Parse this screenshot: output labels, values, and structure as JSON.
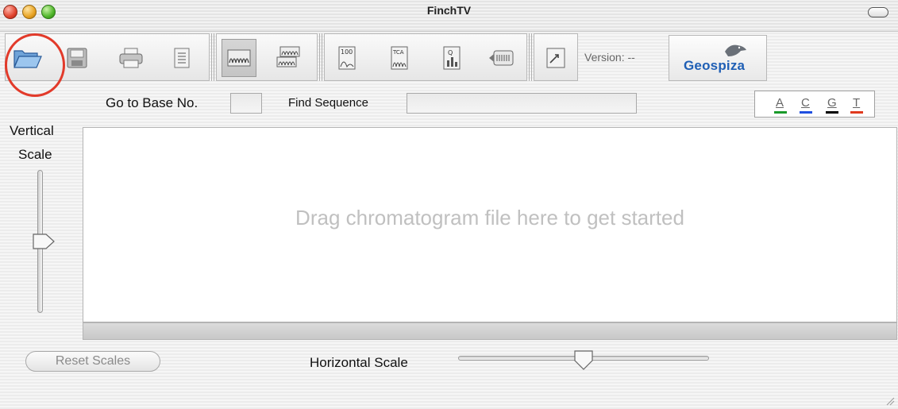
{
  "window": {
    "title": "FinchTV"
  },
  "toolbar": {
    "version_label": "Version: --",
    "brand": "Geospiza",
    "buttons": [
      {
        "name": "open-file-button",
        "icon": "folder-open-icon"
      },
      {
        "name": "save-button",
        "icon": "floppy-disk-icon"
      },
      {
        "name": "print-button",
        "icon": "printer-icon"
      },
      {
        "name": "sequence-text-button",
        "icon": "document-lines-icon"
      },
      {
        "name": "single-view-button",
        "icon": "chromatogram-icon",
        "pressed": true
      },
      {
        "name": "multi-view-button",
        "icon": "stacked-chromatogram-icon"
      },
      {
        "name": "quality-100-button",
        "icon": "peak-100-icon"
      },
      {
        "name": "tca-button",
        "icon": "tca-chromatogram-icon"
      },
      {
        "name": "quality-values-button",
        "icon": "bar-chart-icon"
      },
      {
        "name": "scroll-sequence-button",
        "icon": "scroll-icon"
      },
      {
        "name": "export-button",
        "icon": "export-arrow-icon"
      }
    ]
  },
  "navigation": {
    "go_to_base_label": "Go to Base No.",
    "go_to_base_value": "",
    "find_sequence_label": "Find Sequence",
    "find_sequence_value": ""
  },
  "bases": [
    {
      "letter": "A",
      "color": "#1a9a2a"
    },
    {
      "letter": "C",
      "color": "#1f4fe0"
    },
    {
      "letter": "G",
      "color": "#000000"
    },
    {
      "letter": "T",
      "color": "#e03a1e"
    }
  ],
  "vertical_scale": {
    "label_line1": "Vertical",
    "label_line2": "Scale",
    "level": 0.5
  },
  "plot": {
    "placeholder": "Drag chromatogram file here to get started"
  },
  "bottom": {
    "reset_label": "Reset Scales",
    "horizontal_scale_label": "Horizontal Scale",
    "horizontal_level": 0.5
  },
  "colors": {
    "highlight_circle": "#e23a2a",
    "brand": "#1f5fb5"
  }
}
